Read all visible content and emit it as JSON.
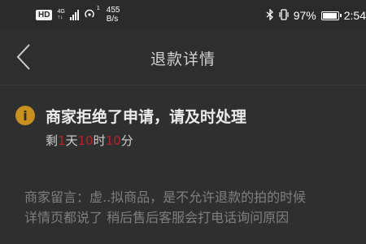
{
  "status_bar": {
    "hd": "HD",
    "network": "4G",
    "network_sub": "↑↓",
    "hotspot_count": "1",
    "speed_value": "455",
    "speed_unit": "B/s",
    "battery_percent": "97%",
    "battery_level": 0.97,
    "time": "2:54"
  },
  "nav": {
    "title": "退款详情"
  },
  "refund_status": {
    "title": "商家拒绝了申请，请及时处理",
    "countdown_prefix": "剩",
    "days": "1",
    "days_unit": "天",
    "hours": "10",
    "hours_unit": "时",
    "minutes": "10",
    "minutes_unit": "分"
  },
  "merchant_message": {
    "line1": "商家留言：虚..拟商品，是不允许退款的拍的时候",
    "line2": "详情页都说了 稍后售后客服会打电话询问原因"
  },
  "colors": {
    "background": "#2f2f2f",
    "warning": "#c8901f",
    "countdown_number": "#b2262a"
  }
}
